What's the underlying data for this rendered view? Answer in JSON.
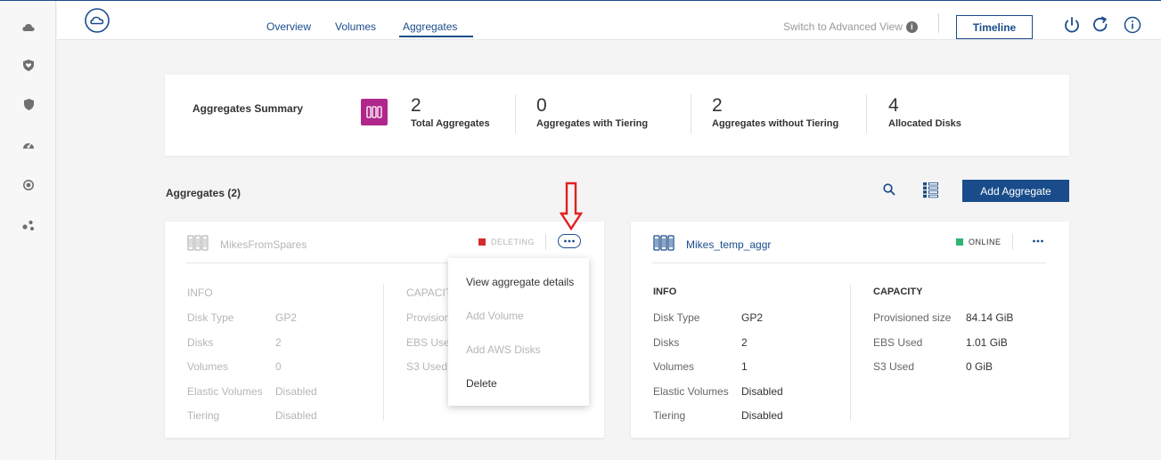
{
  "header": {
    "tabs": [
      {
        "label": "Overview",
        "active": false
      },
      {
        "label": "Volumes",
        "active": false
      },
      {
        "label": "Aggregates",
        "active": true
      }
    ],
    "switch_view_label": "Switch to Advanced View",
    "timeline_label": "Timeline",
    "icons": [
      "power-icon",
      "refresh-icon",
      "info-icon"
    ]
  },
  "sidebar": {
    "icons": [
      "cloud-icon",
      "heart-shield-icon",
      "shield-icon",
      "gauge-icon",
      "target-icon",
      "nodes-icon"
    ]
  },
  "summary": {
    "title": "Aggregates Summary",
    "stats": [
      {
        "value": "2",
        "label": "Total Aggregates"
      },
      {
        "value": "0",
        "label": "Aggregates with Tiering"
      },
      {
        "value": "2",
        "label": "Aggregates without Tiering"
      },
      {
        "value": "4",
        "label": "Allocated Disks"
      }
    ],
    "badge_color": "#b0278c"
  },
  "list": {
    "title": "Aggregates (2)",
    "add_button": "Add Aggregate"
  },
  "aggregates": [
    {
      "name": "MikesFromSpares",
      "status": "DELETING",
      "status_color": "#d42a2a",
      "info_title": "INFO",
      "capacity_title": "CAPACIT",
      "info": [
        {
          "label": "Disk Type",
          "value": "GP2"
        },
        {
          "label": "Disks",
          "value": "2"
        },
        {
          "label": "Volumes",
          "value": "0"
        },
        {
          "label": "Elastic Volumes",
          "value": "Disabled"
        },
        {
          "label": "Tiering",
          "value": "Disabled"
        }
      ],
      "capacity": [
        {
          "label": "Provision"
        },
        {
          "label": "EBS Used"
        },
        {
          "label": "S3 Used"
        }
      ]
    },
    {
      "name": "Mikes_temp_aggr",
      "status": "ONLINE",
      "status_color": "#2fb573",
      "info_title": "INFO",
      "capacity_title": "CAPACITY",
      "info": [
        {
          "label": "Disk Type",
          "value": "GP2"
        },
        {
          "label": "Disks",
          "value": "2"
        },
        {
          "label": "Volumes",
          "value": "1"
        },
        {
          "label": "Elastic Volumes",
          "value": "Disabled"
        },
        {
          "label": "Tiering",
          "value": "Disabled"
        }
      ],
      "capacity": [
        {
          "label": "Provisioned size",
          "value": "84.14 GiB"
        },
        {
          "label": "EBS Used",
          "value": "1.01 GiB"
        },
        {
          "label": "S3 Used",
          "value": "0 GiB"
        }
      ]
    }
  ],
  "context_menu": {
    "items": [
      {
        "label": "View aggregate details",
        "enabled": true
      },
      {
        "label": "Add Volume",
        "enabled": false
      },
      {
        "label": "Add AWS Disks",
        "enabled": false
      },
      {
        "label": "Delete",
        "enabled": true
      }
    ]
  },
  "colors": {
    "primary": "#1a4c8b",
    "annotation_arrow": "#e02020"
  }
}
